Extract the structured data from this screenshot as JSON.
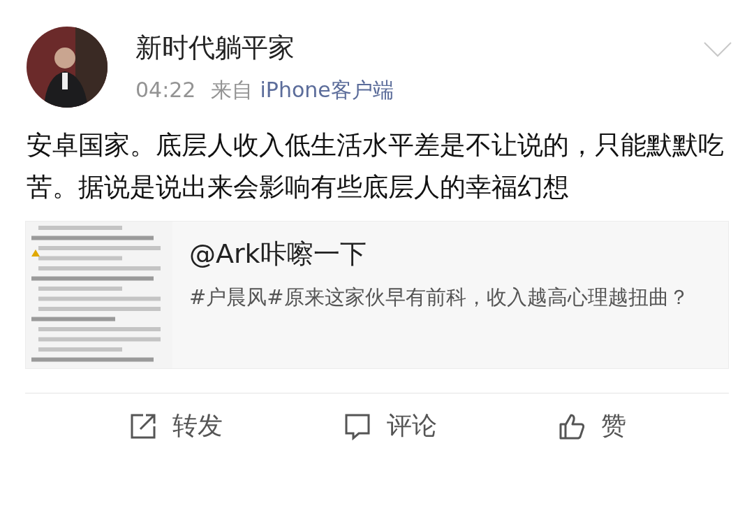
{
  "post": {
    "author": "新时代躺平家",
    "time": "04:22",
    "source_prefix": "来自",
    "source": "iPhone客户端",
    "text": "安卓国家。底层人收入低生活水平差是不让说的，只能默默吃苦。据说是说出来会影响有些底层人的幸福幻想"
  },
  "shared_card": {
    "title": "@Ark咔嚓一下",
    "description": "#户晨风#原来这家伙早有前科，收入越高心理越扭曲？"
  },
  "actions": [
    {
      "kind": "repost",
      "label": "转发"
    },
    {
      "kind": "comment",
      "label": "评论"
    },
    {
      "kind": "like",
      "label": "赞"
    }
  ]
}
